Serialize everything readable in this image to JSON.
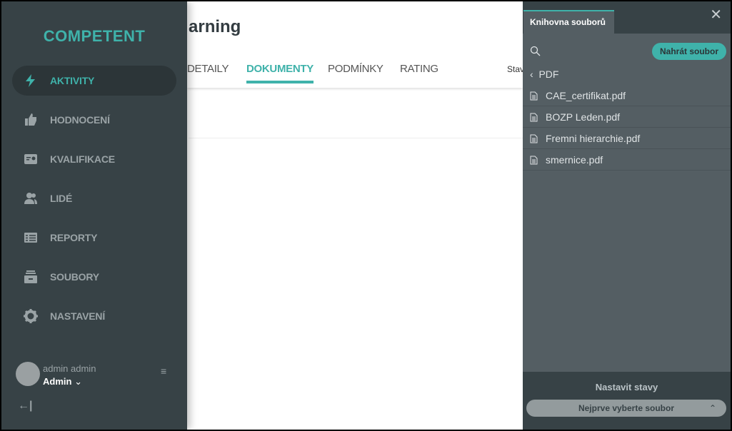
{
  "app": {
    "logo": "COMPETENT",
    "accent": "#3fb2aa"
  },
  "sidebar": {
    "items": [
      {
        "label": "AKTIVITY",
        "icon": "bolt-icon",
        "active": true
      },
      {
        "label": "HODNOCENÍ",
        "icon": "thumbs-up-icon"
      },
      {
        "label": "KVALIFIKACE",
        "icon": "certificate-icon"
      },
      {
        "label": "LIDÉ",
        "icon": "people-icon"
      },
      {
        "label": "REPORTY",
        "icon": "table-icon"
      },
      {
        "label": "SOUBORY",
        "icon": "archive-icon"
      },
      {
        "label": "NASTAVENÍ",
        "icon": "gear-icon"
      }
    ],
    "user": {
      "name": "admin admin",
      "role": "Admin"
    }
  },
  "main": {
    "title": "arning",
    "tabs": [
      {
        "label": "DETAILY"
      },
      {
        "label": "DOKUMENTY",
        "active": true
      },
      {
        "label": "PODMÍNKY"
      },
      {
        "label": "RATING"
      }
    ],
    "status_label": "Stav"
  },
  "panel": {
    "tab": "Knihovna souborů",
    "upload": "Nahrát soubor",
    "folder": "PDF",
    "files": [
      "CAE_certifikat.pdf",
      "BOZP Leden.pdf",
      "Fremni hierarchie.pdf",
      "smernice.pdf"
    ],
    "footer_title": "Nastavit stavy",
    "select_placeholder": "Nejprve vyberte soubor"
  }
}
